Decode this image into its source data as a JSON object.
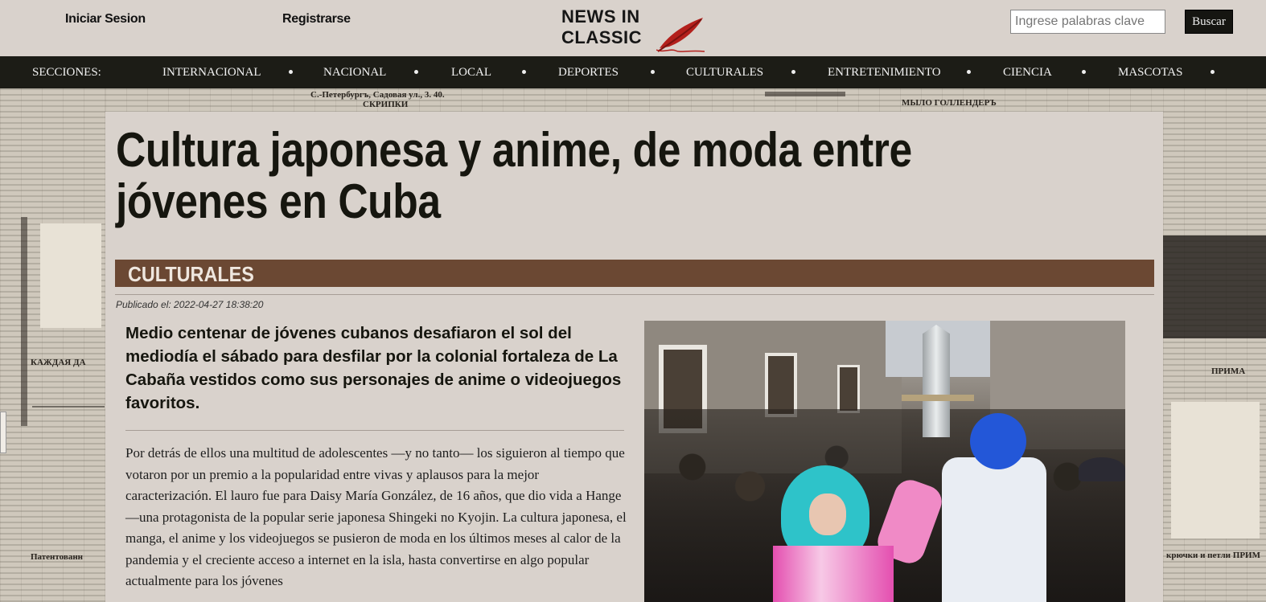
{
  "header": {
    "login_label": "Iniciar Sesion",
    "register_label": "Registrarse",
    "logo_line1": "NEWS IN",
    "logo_line2": "CLASSIC",
    "search_placeholder": "Ingrese palabras clave",
    "search_button": "Buscar"
  },
  "nav": {
    "sections_label": "SECCIONES:",
    "items": [
      "INTERNACIONAL",
      "NACIONAL",
      "LOCAL",
      "DEPORTES",
      "CULTURALES",
      "ENTRETENIMIENTO",
      "CIENCIA",
      "MASCOTAS"
    ]
  },
  "article": {
    "title": "Cultura japonesa y anime, de moda entre jóvenes en Cuba",
    "section": "CULTURALES",
    "published": "Publicado el: 2022-04-27 18:38:20",
    "lead": "Medio centenar de jóvenes cubanos desafiaron el sol del mediodía el sábado para desfilar por la colonial fortaleza de La Cabaña vestidos como sus personajes de anime o videojuegos favoritos.",
    "body": "Por detrás de ellos una multitud de adolescentes —y no tanto— los siguieron al tiempo que votaron por un premio a la popularidad entre vivas y aplausos para la mejor caracterización. El lauro fue para Daisy María González, de 16 años, que dio vida a Hange —una protagonista de la popular serie japonesa Shingeki no Kyojin. La cultura japonesa, el manga, el anime y los videojuegos se pusieron de moda en los últimos meses al calor de la pandemia y el creciente acceso a internet en la isla, hasta convertirse en algo popular actualmente para los jóvenes"
  },
  "background": {
    "snippets": [
      "С.-Петербургъ, Садовая ул., 3. 40.",
      "СКРИПКИ",
      "МЫЛО ГОЛЛЕНДЕРЪ",
      "КАЖДАЯ ДА",
      "Патентованн",
      "крючки и петли ПРИМ",
      "ПРИМА"
    ]
  },
  "colors": {
    "page_bg": "#d9d2cc",
    "nav_bg": "#1c1c16",
    "section_bar": "#6b4833"
  }
}
